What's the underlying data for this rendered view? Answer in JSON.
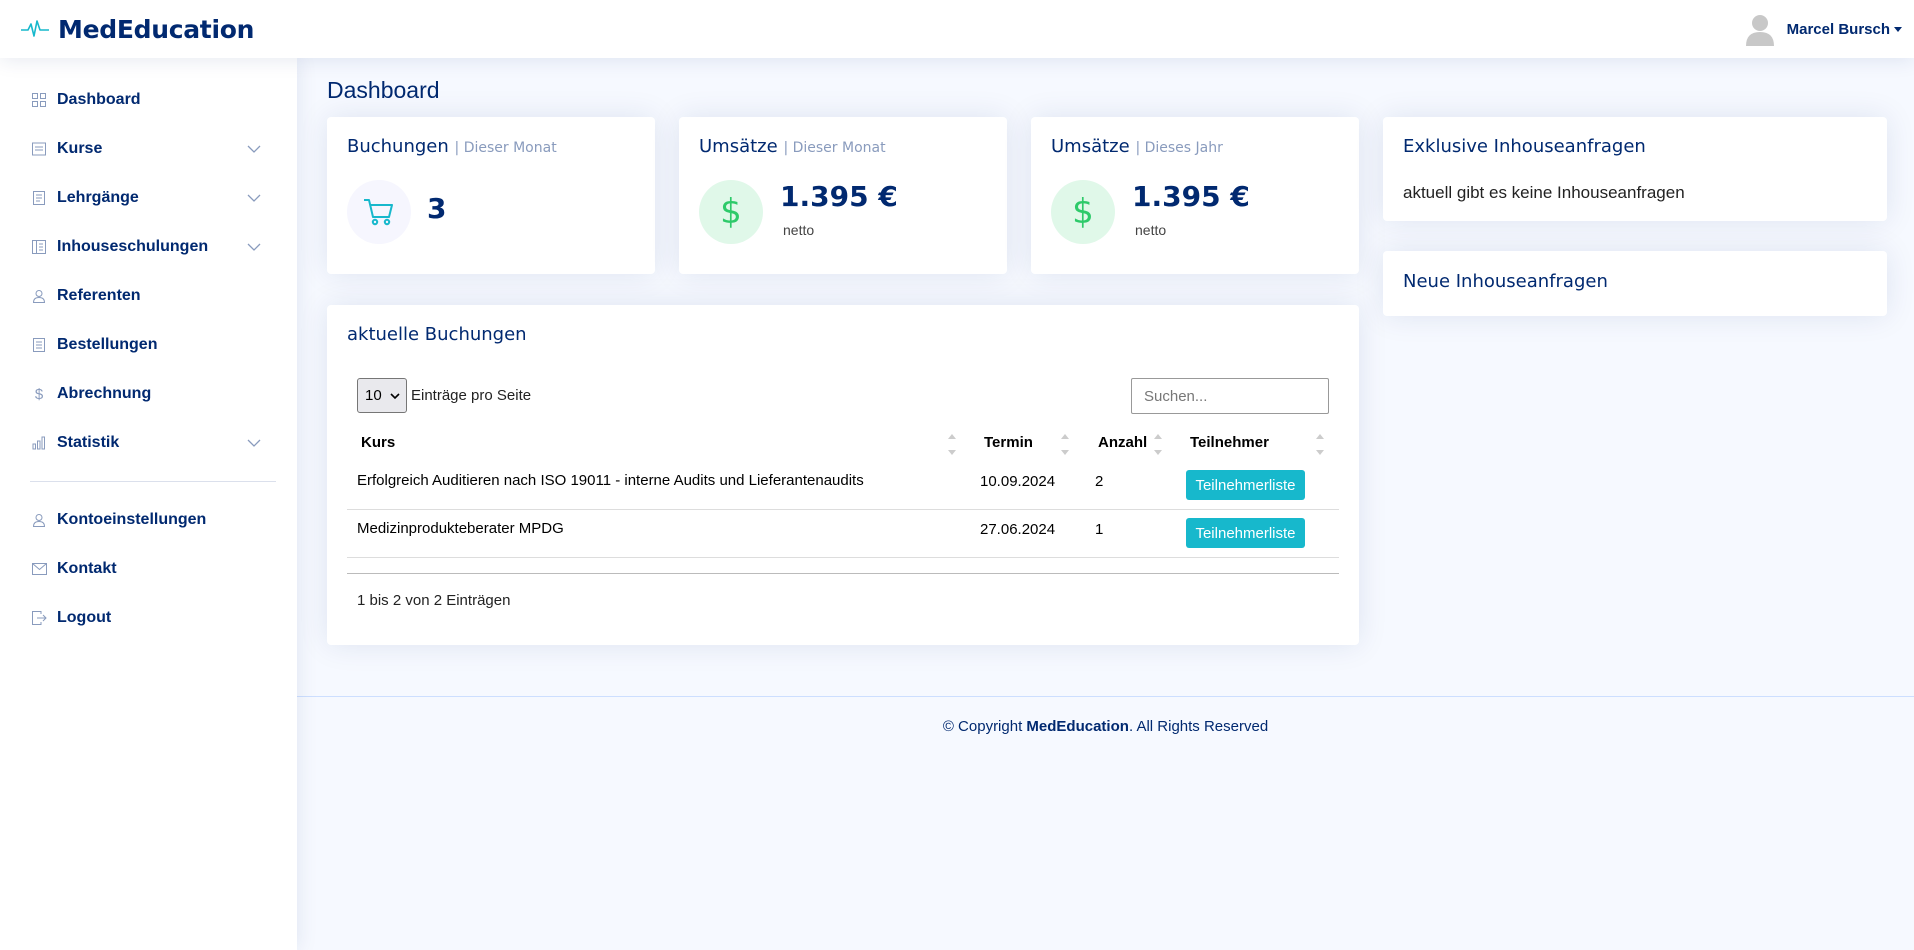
{
  "header": {
    "logo_text": "MedEducation",
    "user_name": "Marcel Bursch"
  },
  "sidebar": {
    "items": [
      {
        "label": "Dashboard",
        "icon": "grid-icon"
      },
      {
        "label": "Kurse",
        "icon": "journal-icon",
        "has_children": true
      },
      {
        "label": "Lehrgänge",
        "icon": "journal-text-icon",
        "has_children": true
      },
      {
        "label": "Inhouseschulungen",
        "icon": "layout-text-icon",
        "has_children": true
      },
      {
        "label": "Referenten",
        "icon": "person-icon"
      },
      {
        "label": "Bestellungen",
        "icon": "receipt-icon"
      },
      {
        "label": "Abrechnung",
        "icon": "dollar-icon"
      },
      {
        "label": "Statistik",
        "icon": "bar-chart-icon",
        "has_children": true
      }
    ],
    "bottom_items": [
      {
        "label": "Kontoeinstellungen",
        "icon": "person-icon"
      },
      {
        "label": "Kontakt",
        "icon": "envelope-icon"
      },
      {
        "label": "Logout",
        "icon": "box-arrow-right-icon"
      }
    ]
  },
  "main": {
    "page_title": "Dashboard",
    "cards": {
      "bookings": {
        "title": "Buchungen",
        "subtitle": "| Dieser Monat",
        "value": "3"
      },
      "revenue_month": {
        "title": "Umsätze",
        "subtitle": "| Dieser Monat",
        "value": "1.395 €",
        "note": "netto"
      },
      "revenue_year": {
        "title": "Umsätze",
        "subtitle": "| Dieses Jahr",
        "value": "1.395 €",
        "note": "netto"
      }
    },
    "exclusive_requests": {
      "title": "Exklusive Inhouseanfragen",
      "text": "aktuell gibt es keine Inhouseanfragen"
    },
    "new_requests": {
      "title": "Neue Inhouseanfragen"
    },
    "bookings_table": {
      "title": "aktuelle Buchungen",
      "per_page_value": "10",
      "per_page_label": "Einträge pro Seite",
      "search_placeholder": "Suchen...",
      "columns": [
        "Kurs",
        "Termin",
        "Anzahl",
        "Teilnehmer"
      ],
      "rows": [
        {
          "course": "Erfolgreich Auditieren nach ISO 19011 - interne Audits und Lieferantenaudits",
          "date": "10.09.2024",
          "count": "2",
          "button": "Teilnehmerliste"
        },
        {
          "course": "Medizinprodukteberater MPDG",
          "date": "27.06.2024",
          "count": "1",
          "button": "Teilnehmerliste"
        }
      ],
      "info": "1 bis 2 von 2 Einträgen"
    }
  },
  "footer": {
    "prefix": "© Copyright ",
    "brand": "MedEducation",
    "suffix": ". All Rights Reserved"
  },
  "colors": {
    "primary": "#012970",
    "accent": "#17b8cc",
    "muted": "#899bbd",
    "success_bg": "#e0f8e9",
    "success": "#2eca6a"
  }
}
